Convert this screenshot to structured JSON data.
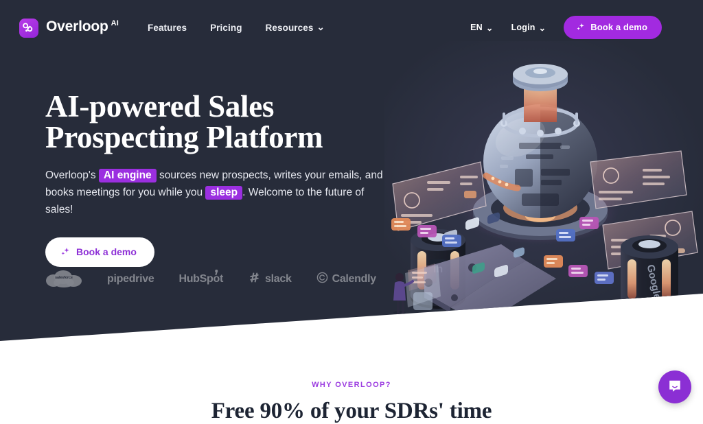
{
  "meta": {
    "accent_purple": "#a22ae0",
    "highlight_purple": "#9b2fe0",
    "hero_background": "#272c3a",
    "page_background": "#ffffff"
  },
  "nav": {
    "brand": {
      "name": "Overloop",
      "superscript": "AI",
      "mark_icon": "overloop-logo-icon"
    },
    "links": [
      {
        "label": "Features",
        "has_caret": false
      },
      {
        "label": "Pricing",
        "has_caret": false
      },
      {
        "label": "Resources",
        "has_caret": true,
        "caret": "⌄"
      }
    ],
    "language": {
      "label": "EN",
      "caret": "⌄"
    },
    "login": {
      "label": "Login",
      "caret": "⌄"
    },
    "cta": {
      "label": "Book a demo",
      "icon": "sparkle-icon"
    }
  },
  "hero": {
    "title_line_1": "AI-powered Sales",
    "title_line_2": "Prospecting Platform",
    "subheading": {
      "part_1": "Overloop's ",
      "highlight_1": "AI engine",
      "part_2": " sources new prospects, writes your emails, and books meetings for you while you ",
      "highlight_2": "sleep",
      "part_3": ". Welcome to the future of sales!"
    },
    "cta": {
      "label": "Book a demo",
      "icon": "sparkle-icon"
    },
    "illustration": {
      "name": "ai-sales-machine-illustration",
      "elements": [
        "central-orb-machine",
        "projected-logo-hologram",
        "left-floating-card",
        "right-floating-card-top",
        "right-floating-card-bottom",
        "linkedin-pillar",
        "google-pillar",
        "conveyor-belt",
        "person-at-screen"
      ],
      "pillar_labels": [
        "in",
        "Google"
      ]
    }
  },
  "partners": {
    "logos": [
      {
        "name": "salesforce",
        "label": "salesforce",
        "type": "cloud"
      },
      {
        "name": "pipedrive",
        "label": "pipedrive",
        "type": "wordmark"
      },
      {
        "name": "hubspot",
        "label": "HubSpot",
        "type": "wordmark-sprocket"
      },
      {
        "name": "slack",
        "label": "slack",
        "type": "glyph-wordmark"
      },
      {
        "name": "calendly",
        "label": "Calendly",
        "type": "glyph-wordmark"
      }
    ]
  },
  "why_section": {
    "eyebrow": "WHY OVERLOOP?",
    "title": "Free 90% of your SDRs' time"
  },
  "chat": {
    "launcher_icon": "chat-bubble-icon",
    "launcher_color": "#8b2fd4"
  }
}
